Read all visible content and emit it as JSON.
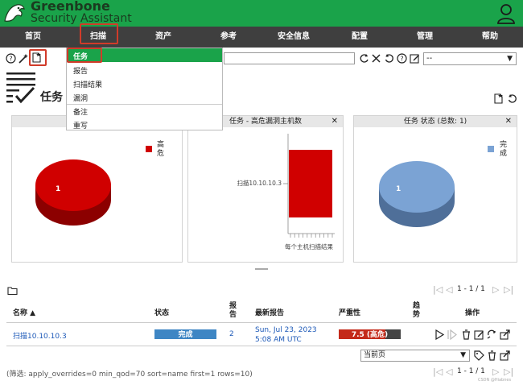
{
  "app": {
    "brand_line1": "Greenbone",
    "brand_line2": "Security Assistant",
    "colors": {
      "header_green": "#1aa34a",
      "nav_dark": "#3f3f3f",
      "accent_red": "#d00000",
      "pie_blue": "#7ba3d4",
      "highlight_red": "#d13b2a"
    }
  },
  "nav": {
    "items": [
      "首页",
      "扫描",
      "资产",
      "参考",
      "安全信息",
      "配置",
      "管理",
      "帮助"
    ]
  },
  "scan_menu": {
    "items": [
      "任务",
      "报告",
      "扫描结果",
      "漏洞",
      "备注",
      "重写"
    ],
    "selected": "任务"
  },
  "toolbar": {
    "filter_value": "",
    "filter_select": "--"
  },
  "page": {
    "title": "任务"
  },
  "charts": [
    {
      "title": "任务",
      "chart_data": {
        "type": "pie",
        "slices": [
          {
            "label": "高危",
            "value": 1,
            "color": "#d00000"
          }
        ],
        "legend": [
          "高危"
        ]
      }
    },
    {
      "title": "任务 - 高危漏洞主机数",
      "chart_data": {
        "type": "bar",
        "categories": [
          "扫描10.10.10.3"
        ],
        "values": [
          1
        ],
        "xlabel": "每个主机扫描结果",
        "orientation": "horizontal"
      }
    },
    {
      "title": "任务 状态 (总数: 1)",
      "chart_data": {
        "type": "pie",
        "slices": [
          {
            "label": "完成",
            "value": 1,
            "color": "#7ba3d4"
          }
        ],
        "legend": [
          "完成"
        ]
      }
    }
  ],
  "pagination": {
    "top": "1 - 1 / 1",
    "bottom": "1 - 1 / 1"
  },
  "table": {
    "headers": {
      "name": "名称 ▲",
      "status": "状态",
      "reports": "报告",
      "last_report": "最新报告",
      "severity": "严重性",
      "trend": "趋势",
      "actions": "操作"
    },
    "rows": [
      {
        "name": "扫描10.10.10.3",
        "status": "完成",
        "reports": "2",
        "last_report_line1": "Sun, Jul 23, 2023",
        "last_report_line2": "5:08 AM UTC",
        "severity": "7.5 (高危)",
        "severity_value": 7.5
      }
    ],
    "bulk_select": "当前页"
  },
  "footer": {
    "filter_text": "(筛选: apply_overrides=0 min_qod=70 sort=name first=1 rows=10)",
    "watermark": "CSDN @Hiabnes"
  }
}
